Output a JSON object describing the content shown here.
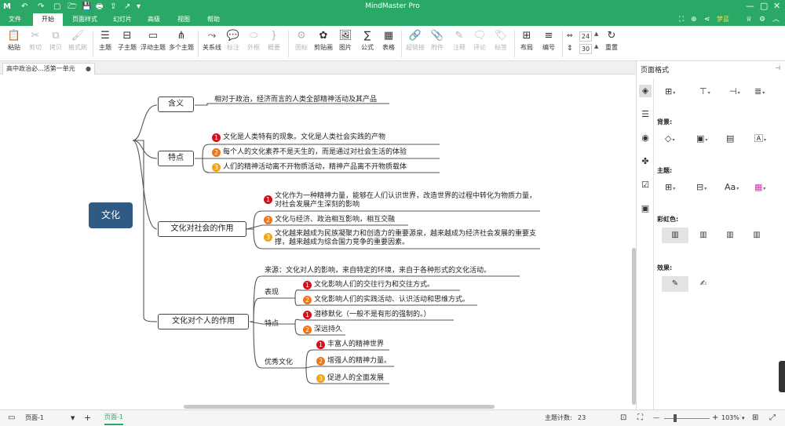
{
  "app": {
    "title": "MindMaster Pro",
    "user": "梦蓝"
  },
  "quick_access": {
    "icons": [
      "app-logo-icon",
      "undo-icon",
      "redo-icon",
      "new-file-icon",
      "open-folder-icon",
      "save-icon",
      "print-icon",
      "export-icon",
      "share-icon",
      "customize-icon"
    ],
    "glyphs": [
      "M",
      "↶",
      "↷",
      "▢",
      "🗁",
      "💾",
      "🖶",
      "⇪",
      "↗",
      "▾"
    ]
  },
  "tabs": [
    {
      "label": "文件",
      "active": false
    },
    {
      "label": "开始",
      "active": true
    },
    {
      "label": "页面样式",
      "active": false
    },
    {
      "label": "幻灯片",
      "active": false
    },
    {
      "label": "高级",
      "active": false
    },
    {
      "label": "视图",
      "active": false
    },
    {
      "label": "帮助",
      "active": false
    }
  ],
  "ribbon": {
    "buttons": [
      {
        "label": "粘贴",
        "icon": "paste-icon",
        "glyph": "📋",
        "disabled": false
      },
      {
        "label": "剪切",
        "icon": "cut-icon",
        "glyph": "✂",
        "disabled": true
      },
      {
        "label": "拷贝",
        "icon": "copy-icon",
        "glyph": "⧉",
        "disabled": true
      },
      {
        "label": "格式刷",
        "icon": "format-painter-icon",
        "glyph": "🖌",
        "disabled": true
      },
      {
        "label": "主题",
        "icon": "topic-icon",
        "glyph": "☰",
        "disabled": false
      },
      {
        "label": "子主题",
        "icon": "subtopic-icon",
        "glyph": "⊟",
        "disabled": false
      },
      {
        "label": "浮动主题",
        "icon": "floating-topic-icon",
        "glyph": "▭",
        "disabled": false
      },
      {
        "label": "多个主题",
        "icon": "multiple-topics-icon",
        "glyph": "⋔",
        "disabled": false
      },
      {
        "label": "关系线",
        "icon": "relationship-icon",
        "glyph": "⤳",
        "disabled": false
      },
      {
        "label": "标注",
        "icon": "callout-icon",
        "glyph": "💬",
        "disabled": true
      },
      {
        "label": "外框",
        "icon": "boundary-icon",
        "glyph": "⬭",
        "disabled": true
      },
      {
        "label": "概要",
        "icon": "summary-icon",
        "glyph": "}",
        "disabled": true
      },
      {
        "label": "图标",
        "icon": "icon-picker-icon",
        "glyph": "⚙",
        "disabled": true
      },
      {
        "label": "剪贴画",
        "icon": "clipart-icon",
        "glyph": "✿",
        "disabled": false
      },
      {
        "label": "图片",
        "icon": "image-icon",
        "glyph": "🖼",
        "disabled": false
      },
      {
        "label": "公式",
        "icon": "formula-icon",
        "glyph": "∑",
        "disabled": false
      },
      {
        "label": "表格",
        "icon": "table-icon",
        "glyph": "▦",
        "disabled": false
      },
      {
        "label": "超链接",
        "icon": "hyperlink-icon",
        "glyph": "🔗",
        "disabled": true
      },
      {
        "label": "附件",
        "icon": "attachment-icon",
        "glyph": "📎",
        "disabled": true
      },
      {
        "label": "注释",
        "icon": "note-icon",
        "glyph": "✎",
        "disabled": true
      },
      {
        "label": "评论",
        "icon": "comment-icon",
        "glyph": "🗨",
        "disabled": true
      },
      {
        "label": "标签",
        "icon": "tag-icon",
        "glyph": "🏷",
        "disabled": true
      },
      {
        "label": "布局",
        "icon": "layout-icon",
        "glyph": "⊞",
        "disabled": false
      },
      {
        "label": "编号",
        "icon": "numbering-icon",
        "glyph": "≡",
        "disabled": false
      },
      {
        "label": "重置",
        "icon": "reset-icon",
        "glyph": "↻",
        "disabled": false
      }
    ],
    "spin_top": "24",
    "spin_bottom": "30"
  },
  "document_tab": {
    "label": "高中政治必...活第一单元",
    "dirty_mark": "●"
  },
  "mindmap": {
    "central": "文化",
    "branches": [
      {
        "label": "含义",
        "text": "相对于政治，经济而言的人类全部精神活动及其产品"
      },
      {
        "label": "特点",
        "items": [
          {
            "num": "1",
            "text": "文化是人类特有的现象。文化是人类社会实践的产物"
          },
          {
            "num": "2",
            "text": "每个人的文化素养不是天生的，而是通过对社会生活的体验"
          },
          {
            "num": "3",
            "text": "人们的精神活动离不开物质活动，精神产品离不开物质载体"
          }
        ]
      },
      {
        "label": "文化对社会的作用",
        "items": [
          {
            "num": "1",
            "text": "文化作为一种精神力量，能够在人们认识世界，改造世界的过程中转化为物质力量，对社会发展产生深刻的影响"
          },
          {
            "num": "2",
            "text": "文化与经济、政治相互影响，相互交融"
          },
          {
            "num": "3",
            "text": "文化越来越成为民族凝聚力和创造力的重要源泉，越来越成为经济社会发展的重要支撑，越来越成为综合国力竞争的重要因素。"
          }
        ]
      },
      {
        "label": "文化对个人的作用",
        "source": "来源：文化对人的影响，来自特定的环境，来自于各种形式的文化活动。",
        "subgroups": [
          {
            "label": "表现",
            "items": [
              {
                "num": "1",
                "text": "文化影响人们的交往行为和交往方式。"
              },
              {
                "num": "2",
                "text": "文化影响人们的实践活动、认识活动和思维方式。"
              }
            ]
          },
          {
            "label": "特点",
            "items": [
              {
                "num": "1",
                "text": "潜移默化（一般不是有形的强制的。）"
              },
              {
                "num": "2",
                "text": "深远持久"
              }
            ]
          },
          {
            "label": "优秀文化",
            "items": [
              {
                "num": "1",
                "text": "丰富人的精神世界"
              },
              {
                "num": "2",
                "text": "增强人的精神力量。"
              },
              {
                "num": "3",
                "text": "促进人的全面发展"
              }
            ]
          }
        ]
      }
    ]
  },
  "panel": {
    "title": "页面格式",
    "pin": "⊣",
    "background_label": "背景:",
    "theme_label": "主题:",
    "rainbow_label": "彩虹色:",
    "effect_label": "效果:",
    "side_icons": [
      "page-format-icon",
      "outline-icon",
      "mark-icon",
      "clipart-panel-icon",
      "task-icon",
      "presentation-icon"
    ],
    "side_glyphs": [
      "◈",
      "☰",
      "◉",
      "✤",
      "☑",
      "▣"
    ]
  },
  "colors": {
    "brand": "#2aa866",
    "central": "#2f5a84",
    "badge1": "#d0121c",
    "badge2": "#ee7416",
    "badge3": "#f4a313"
  },
  "status": {
    "page_select": "页面-1",
    "add": "+",
    "page_tab": "页面-1",
    "topic_count_label": "主题计数:",
    "topic_count": "23",
    "zoom": "103%"
  }
}
